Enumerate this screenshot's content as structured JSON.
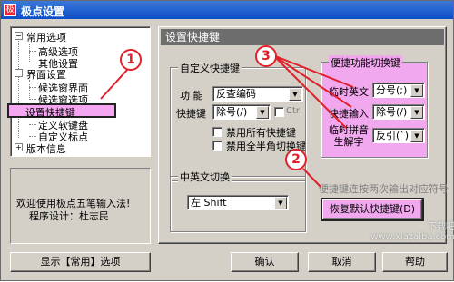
{
  "window": {
    "title": "极点设置",
    "icon": "app-icon"
  },
  "tree": {
    "items": [
      {
        "label": "常用选项"
      },
      {
        "label": "高级选项"
      },
      {
        "label": "其他设置"
      },
      {
        "label": "界面设置"
      },
      {
        "label": "候选窗界面"
      },
      {
        "label": "候选窗选项"
      },
      {
        "label": "设置快捷键"
      },
      {
        "label": "定义软键盘"
      },
      {
        "label": "自定义标点"
      },
      {
        "label": "版本信息"
      }
    ]
  },
  "info": {
    "line1": "欢迎使用极点五笔输入法!",
    "line2": "程序设计：杜志民"
  },
  "panel_title": "设置快捷键",
  "custom_group": {
    "title": "自定义快捷键",
    "function_label": "功  能",
    "function_value": "反查编码",
    "hotkey_label": "快捷键",
    "hotkey_value": "除号(/)",
    "ctrl_label": "Ctrl",
    "disable_all": "禁用所有快捷键",
    "disable_fullwidth": "禁用全半角切换键"
  },
  "convenient_group": {
    "title": "便捷功能切换键",
    "rows": [
      {
        "label": "临时英文",
        "value": "分号(;)"
      },
      {
        "label": "快捷输入",
        "value": "除号(/)"
      },
      {
        "label": "临时拼音\n生解字",
        "value": "反引(`)"
      }
    ]
  },
  "hint": "便捷键连按两次输出对应符号",
  "restore_button": "恢复默认快捷键(D)",
  "cn_en_group": {
    "title": "中英文切换",
    "value": "左 Shift"
  },
  "buttons": {
    "show_common": "显示【常用】选项",
    "ok": "确认",
    "cancel": "取消",
    "help": "帮助"
  },
  "callouts": [
    "1",
    "2",
    "3"
  ],
  "accent_colors": {
    "callout": "#e0202a",
    "highlight": "#f5a6f0"
  },
  "watermark": "下载吧 www.xiazaiba.com"
}
